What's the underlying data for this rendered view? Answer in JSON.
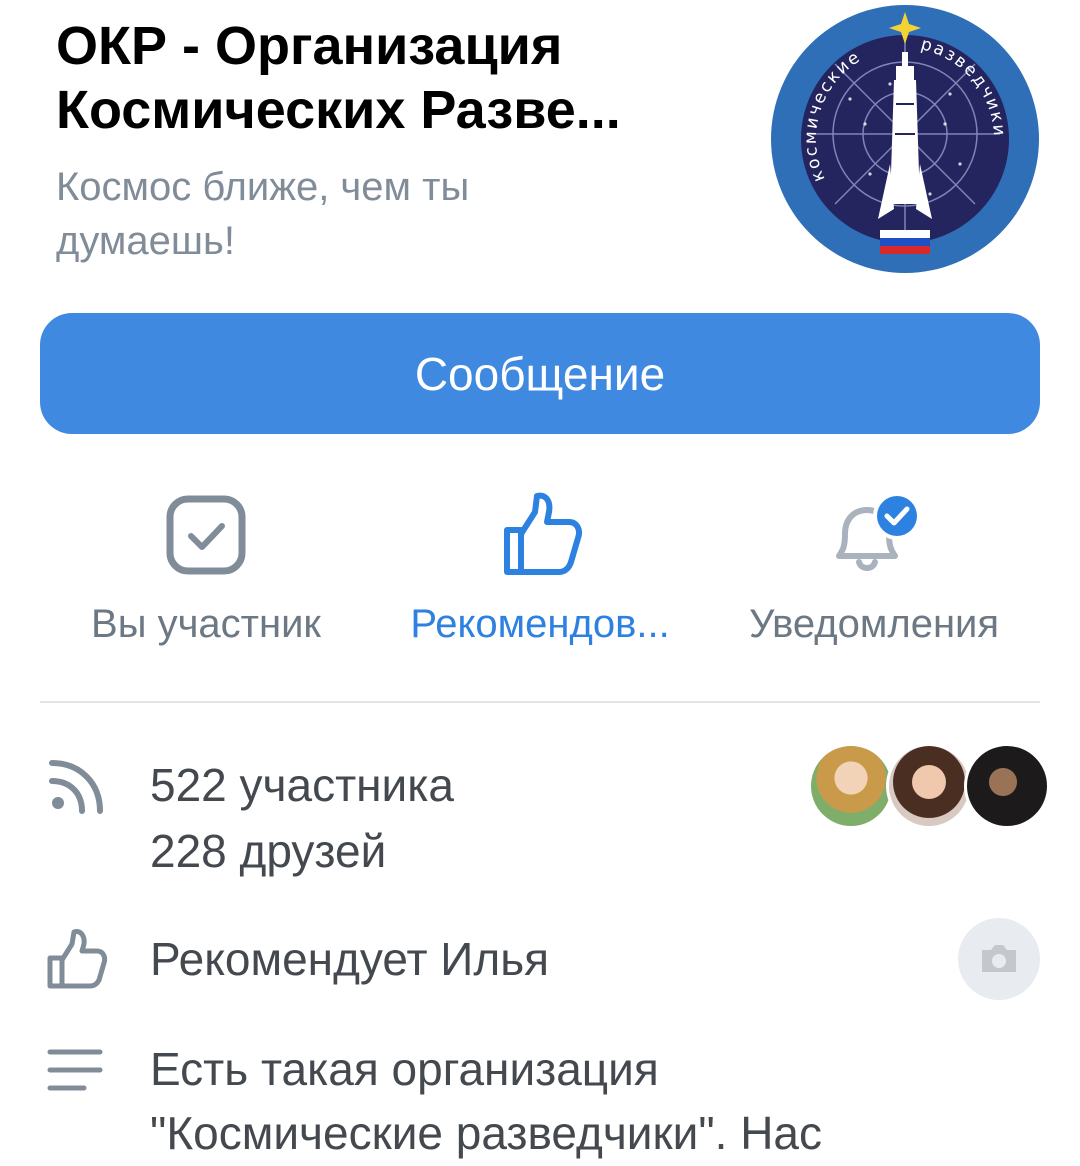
{
  "group": {
    "title_line1": "ОКР - Организация",
    "title_line2": "Космических Разве...",
    "status_line1": "Космос ближе, чем ты",
    "status_line2": "думаешь!",
    "avatar": {
      "arc_left": "космические",
      "arc_right": "разведчики",
      "icon": "rocket-emblem"
    }
  },
  "message_button": {
    "label": "Сообщение"
  },
  "actions": [
    {
      "label": "Вы участник",
      "icon": "checkbox-icon",
      "active": false
    },
    {
      "label": "Рекомендов...",
      "icon": "thumbs-up-icon",
      "active": true
    },
    {
      "label": "Уведомления",
      "icon": "bell-check-icon",
      "active": false
    }
  ],
  "info": {
    "members": "522 участника",
    "friends": "228 друзей",
    "recommends": "Рекомендует Илья",
    "description_line1": "Есть такая организация",
    "description_line2": "\"Космические разведчики\". Нас"
  },
  "colors": {
    "accent": "#3f8ae0",
    "active_text": "#2d81e0",
    "secondary_text": "#818c99",
    "avatar_bg": "#2a2a6e",
    "avatar_ring": "#2f6fb8"
  }
}
